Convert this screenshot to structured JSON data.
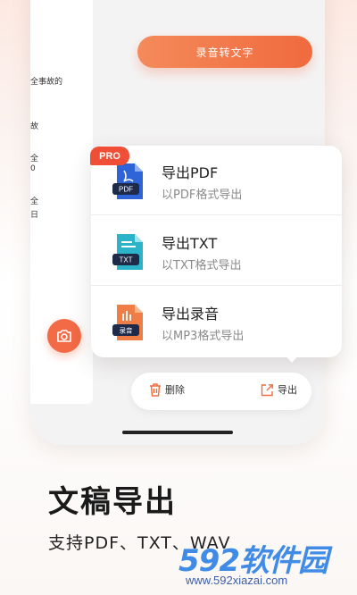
{
  "app": {
    "record_button": "录音转文字",
    "doc_lines": [
      "全事故的",
      "故",
      "全",
      "0",
      "全",
      "日"
    ]
  },
  "export_menu": {
    "pro_badge": "PRO",
    "items": [
      {
        "title": "导出PDF",
        "subtitle": "以PDF格式导出",
        "icon_label": "PDF",
        "icon": "pdf-file-icon",
        "color": "#2f63d8"
      },
      {
        "title": "导出TXT",
        "subtitle": "以TXT格式导出",
        "icon_label": "TXT",
        "icon": "txt-file-icon",
        "color": "#2bb3c9"
      },
      {
        "title": "导出录音",
        "subtitle": "以MP3格式导出",
        "icon_label": "录音",
        "icon": "audio-file-icon",
        "color": "#f07d45"
      }
    ]
  },
  "action_bar": {
    "delete_label": "删除",
    "export_label": "导出"
  },
  "promo": {
    "headline": "文稿导出",
    "subline": "支持PDF、TXT、WAV"
  },
  "watermark": {
    "logo": "592软件园",
    "url": "www.592xiazai.com"
  },
  "colors": {
    "accent": "#f06a3e",
    "pro": "#f04e36"
  }
}
